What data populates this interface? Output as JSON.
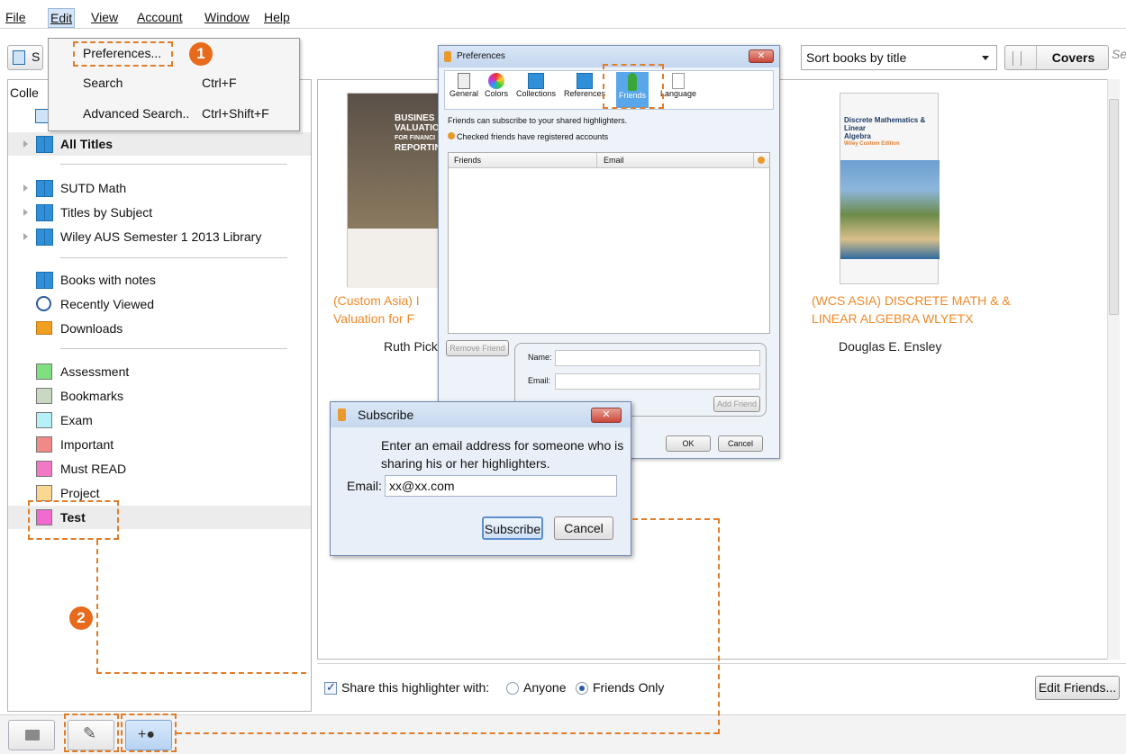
{
  "menubar": {
    "file": "File",
    "edit": "Edit",
    "view": "View",
    "account": "Account",
    "window": "Window",
    "help": "Help"
  },
  "edit_menu": {
    "preferences": "Preferences...",
    "search": "Search",
    "search_shortcut": "Ctrl+F",
    "advanced_search": "Advanced Search..",
    "advanced_shortcut": "Ctrl+Shift+F"
  },
  "toolbar": {
    "sort_value": "Sort books by title",
    "covers_label": "Covers",
    "search_placeholder_fragment": "Se",
    "left_button_fragment": "S"
  },
  "leftpanel": {
    "header_fragment": "Colle",
    "all_titles": "All Titles",
    "collections": [
      "SUTD Math",
      "Titles by Subject",
      "Wiley AUS Semester 1 2013 Library"
    ],
    "special": [
      "Books with notes",
      "Recently Viewed",
      "Downloads"
    ],
    "highlighters": [
      {
        "label": "Assessment",
        "color": "#7fe07f"
      },
      {
        "label": "Bookmarks",
        "color": "#c9d9c1"
      },
      {
        "label": "Exam",
        "color": "#b5f1f7"
      },
      {
        "label": "Important",
        "color": "#f08a86"
      },
      {
        "label": "Must READ",
        "color": "#f278c5"
      },
      {
        "label": "Project",
        "color": "#fbd890"
      },
      {
        "label": "Test",
        "color": "#f26ad0"
      }
    ]
  },
  "books": [
    {
      "title_line1": "(Custom Asia) I",
      "title_line2": "Valuation for F",
      "author": "Ruth Pick",
      "cover_text": [
        "BUSINES",
        "VALUATIO",
        "FOR FINANCI",
        "REPORTIN"
      ]
    },
    {
      "title_line1": "(WCS ASIA) DISCRETE MATH &  &",
      "title_line2": "LINEAR ALGEBRA WLYETX",
      "author": "Douglas E. Ensley",
      "cover_text": [
        "Discrete Mathematics & Linear",
        "Algebra",
        "Wiley Custom Edition"
      ]
    }
  ],
  "preferences": {
    "title": "Preferences",
    "tabs": [
      "General",
      "Colors",
      "Collections",
      "References",
      "Friends",
      "Language"
    ],
    "desc": "Friends can subscribe to your shared highlighters.",
    "checked_note": "Checked friends have registered accounts",
    "col_friends": "Friends",
    "col_email": "Email",
    "remove_friend": "Remove Friend",
    "name_label": "Name:",
    "email_label": "Email:",
    "add_friend": "Add Friend",
    "ok": "OK",
    "cancel": "Cancel"
  },
  "subscribe": {
    "title": "Subscribe",
    "message_line1": "Enter an email address for someone who is",
    "message_line2": "sharing his or her highlighters.",
    "email_label": "Email:",
    "email_value": "xx@xx.com",
    "subscribe_btn": "Subscribe",
    "cancel_btn": "Cancel"
  },
  "sharebar": {
    "share_label": "Share this highlighter with:",
    "anyone": "Anyone",
    "friends_only": "Friends Only",
    "edit_friends": "Edit Friends..."
  },
  "annotations": {
    "step1": "1",
    "step2": "2"
  },
  "colors": {
    "accent_orange": "#e07d2b",
    "title_orange": "#f08a2a"
  }
}
